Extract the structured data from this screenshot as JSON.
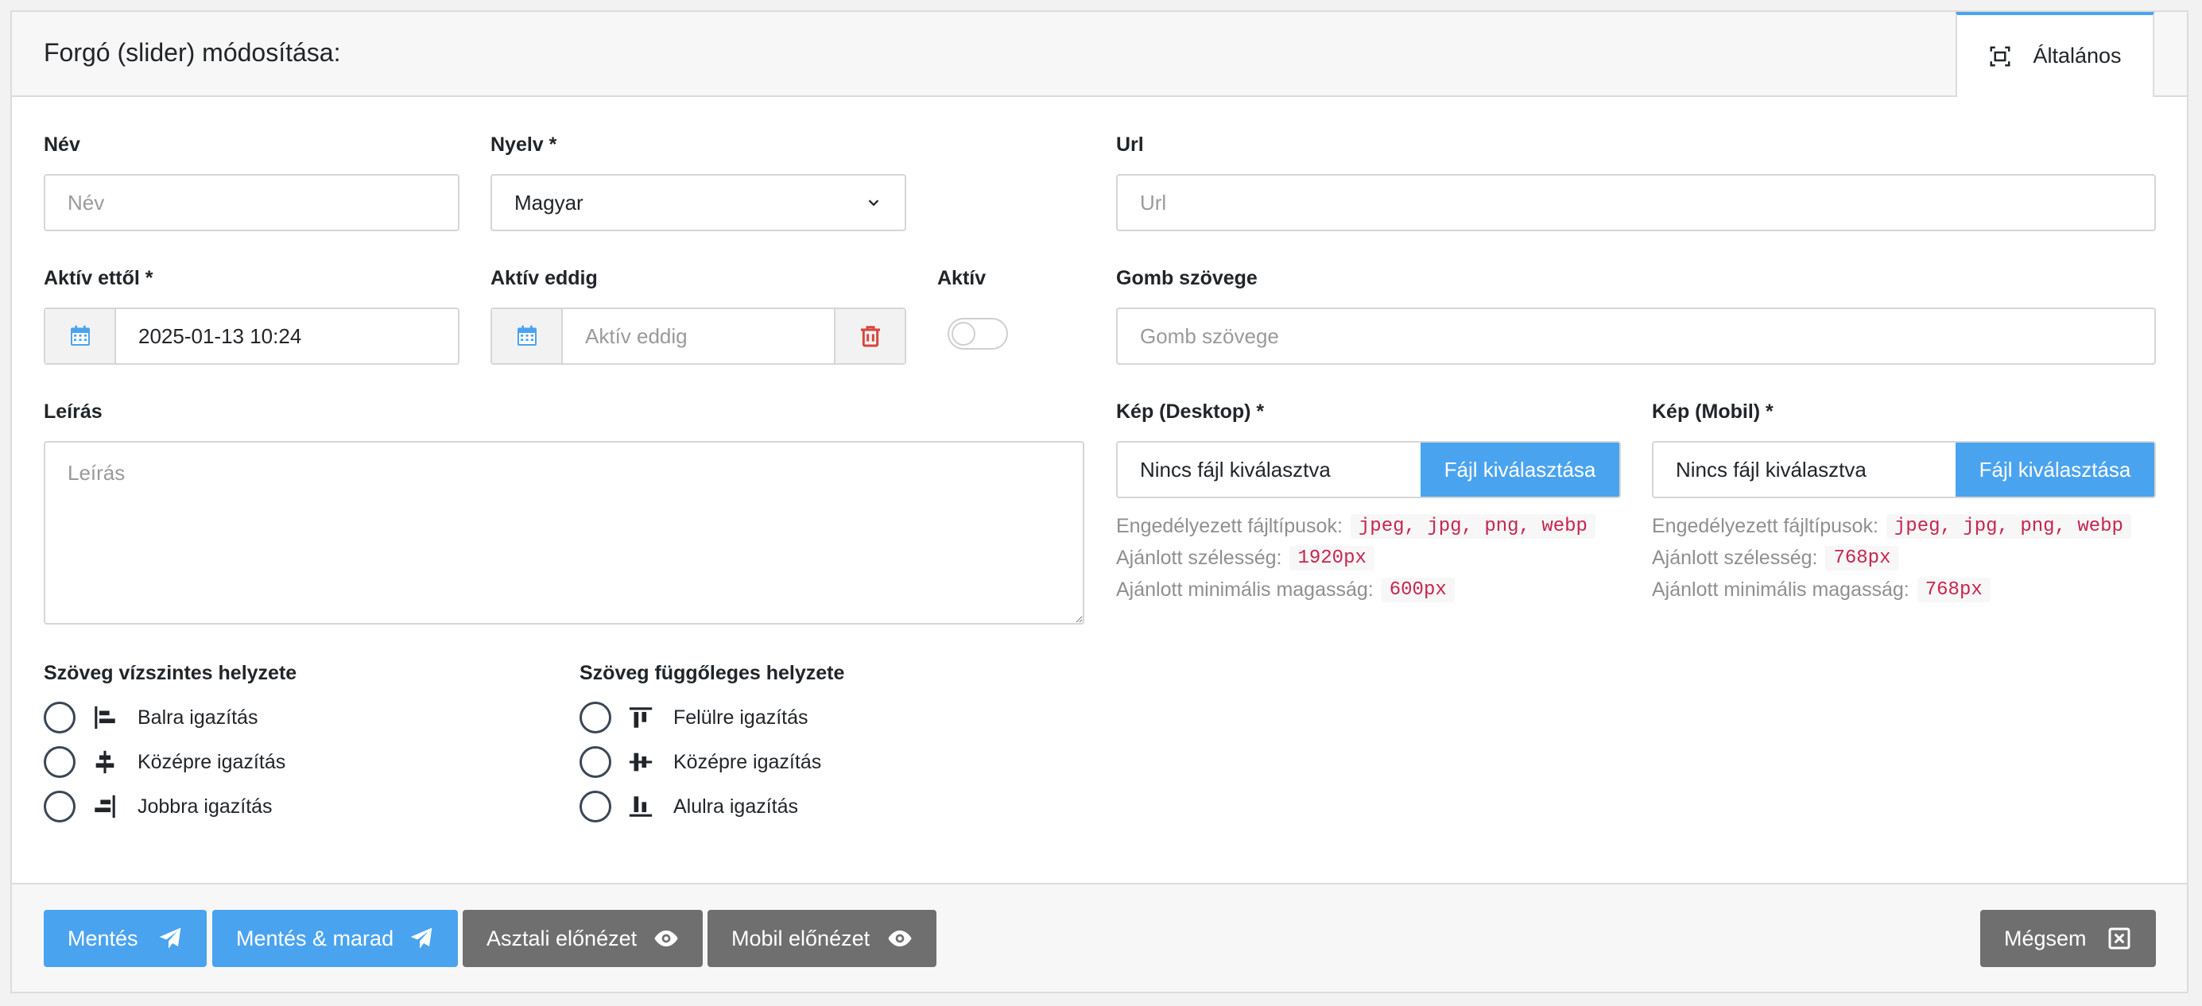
{
  "header": {
    "title": "Forgó (slider) módosítása:",
    "tab_general": "Általános"
  },
  "form": {
    "name": {
      "label": "Név",
      "placeholder": "Név",
      "value": ""
    },
    "language": {
      "label": "Nyelv *",
      "value": "Magyar"
    },
    "url": {
      "label": "Url",
      "placeholder": "Url",
      "value": ""
    },
    "active_from": {
      "label": "Aktív ettől *",
      "value": "2025-01-13 10:24"
    },
    "active_until": {
      "label": "Aktív eddig",
      "placeholder": "Aktív eddig",
      "value": ""
    },
    "active": {
      "label": "Aktív",
      "on": false
    },
    "button_text": {
      "label": "Gomb szövege",
      "placeholder": "Gomb szövege",
      "value": ""
    },
    "description": {
      "label": "Leírás",
      "placeholder": "Leírás",
      "value": ""
    },
    "image_desktop": {
      "label": "Kép (Desktop) *",
      "file_text": "Nincs fájl kiválasztva",
      "button": "Fájl kiválasztása",
      "allowed_label": "Engedélyezett fájltípusok:",
      "allowed_value": "jpeg, jpg, png, webp",
      "width_label": "Ajánlott szélesség:",
      "width_value": "1920px",
      "height_label": "Ajánlott minimális magasság:",
      "height_value": "600px"
    },
    "image_mobile": {
      "label": "Kép (Mobil) *",
      "file_text": "Nincs fájl kiválasztva",
      "button": "Fájl kiválasztása",
      "allowed_label": "Engedélyezett fájltípusok:",
      "allowed_value": "jpeg, jpg, png, webp",
      "width_label": "Ajánlott szélesség:",
      "width_value": "768px",
      "height_label": "Ajánlott minimális magasság:",
      "height_value": "768px"
    },
    "h_align": {
      "label": "Szöveg vízszintes helyzete",
      "options": [
        "Balra igazítás",
        "Középre igazítás",
        "Jobbra igazítás"
      ],
      "icons": [
        "align-left-icon",
        "align-center-icon",
        "align-right-icon"
      ]
    },
    "v_align": {
      "label": "Szöveg függőleges helyzete",
      "options": [
        "Felülre igazítás",
        "Középre igazítás",
        "Alulra igazítás"
      ],
      "icons": [
        "align-top-icon",
        "align-middle-icon",
        "align-bottom-icon"
      ]
    }
  },
  "footer": {
    "save": "Mentés",
    "save_stay": "Mentés & marad",
    "desktop_preview": "Asztali előnézet",
    "mobile_preview": "Mobil előnézet",
    "cancel": "Mégsem"
  },
  "colors": {
    "primary": "#4aa3ef",
    "secondary": "#6f6f6f",
    "danger": "#d9453a",
    "code": "#c7254e"
  }
}
